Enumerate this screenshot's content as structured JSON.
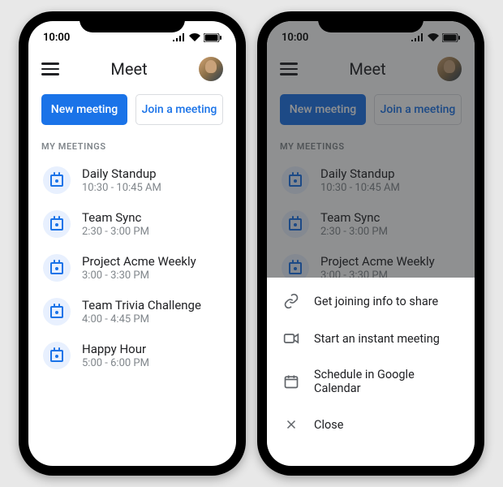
{
  "status": {
    "time": "10:00"
  },
  "header": {
    "title": "Meet"
  },
  "actions": {
    "new_meeting": "New meeting",
    "join_meeting": "Join a meeting"
  },
  "section_label": "MY MEETINGS",
  "meetings": [
    {
      "title": "Daily Standup",
      "time": "10:30 - 10:45 AM"
    },
    {
      "title": "Team Sync",
      "time": "2:30 - 3:00 PM"
    },
    {
      "title": "Project Acme Weekly",
      "time": "3:00 - 3:30 PM"
    },
    {
      "title": "Team Trivia Challenge",
      "time": "4:00 - 4:45 PM"
    },
    {
      "title": "Happy Hour",
      "time": "5:00 - 6:00 PM"
    }
  ],
  "sheet": {
    "items": [
      {
        "icon": "link-icon",
        "label": "Get joining info to share"
      },
      {
        "icon": "video-icon",
        "label": "Start an instant meeting"
      },
      {
        "icon": "calendar-icon",
        "label": "Schedule in Google Calendar"
      },
      {
        "icon": "close-icon",
        "label": "Close"
      }
    ]
  },
  "colors": {
    "primary": "#1a73e8"
  }
}
